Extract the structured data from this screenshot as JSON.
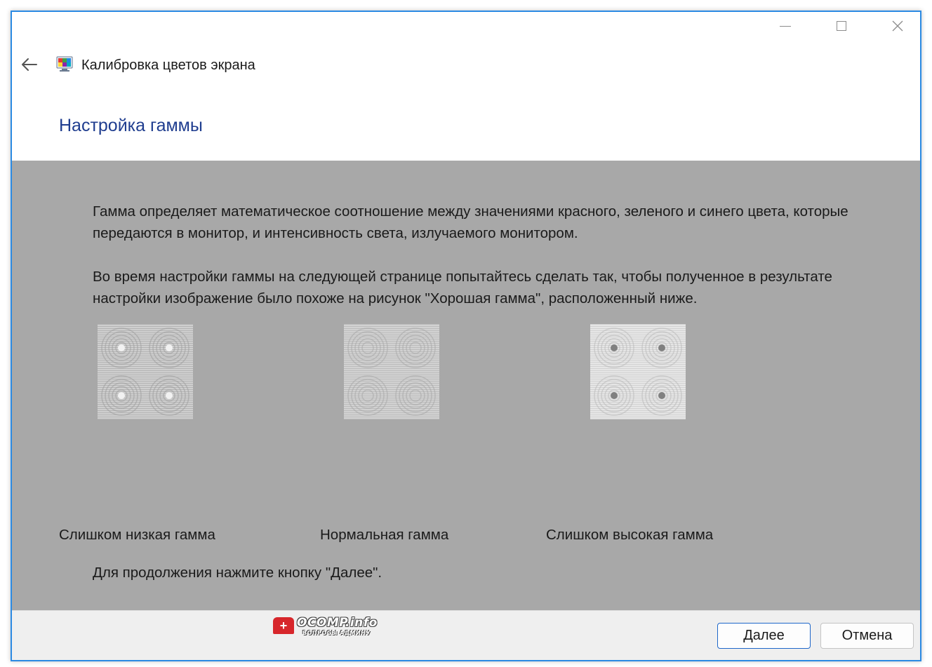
{
  "window": {
    "app_title": "Калибровка цветов экрана",
    "accent_color": "#2b8ae3"
  },
  "caption_buttons": {
    "minimize_icon": "minimize-icon",
    "maximize_icon": "maximize-icon",
    "close_icon": "close-icon"
  },
  "nav": {
    "back_icon": "back-arrow-icon",
    "app_icon": "display-color-calibration-icon"
  },
  "page": {
    "title": "Настройка гаммы",
    "title_color": "#1f3d8f",
    "paragraph1": "Гамма определяет математическое соотношение между значениями красного, зеленого и синего цвета, которые передаются в монитор, и интенсивность света, излучаемого монитором.",
    "paragraph2": "Во время настройки гаммы на следующей странице попытайтесь сделать так, чтобы полученное в результате настройки изображение было похоже на рисунок \"Хорошая гамма\", расположенный ниже.",
    "content_background": "#a8a8a8"
  },
  "samples": [
    {
      "caption": "Слишком низкая гамма",
      "dot_style": "light"
    },
    {
      "caption": "Нормальная гамма",
      "dot_style": "none"
    },
    {
      "caption": "Слишком высокая гамма",
      "dot_style": "dark"
    }
  ],
  "instruction": "Для продолжения нажмите кнопку \"Далее\".",
  "footer": {
    "next_label": "Далее",
    "cancel_label": "Отмена"
  },
  "watermark": {
    "badge": "+",
    "name": "OCOMP.info",
    "subtitle": "ВОПРОСЫ АДМИНУ"
  }
}
